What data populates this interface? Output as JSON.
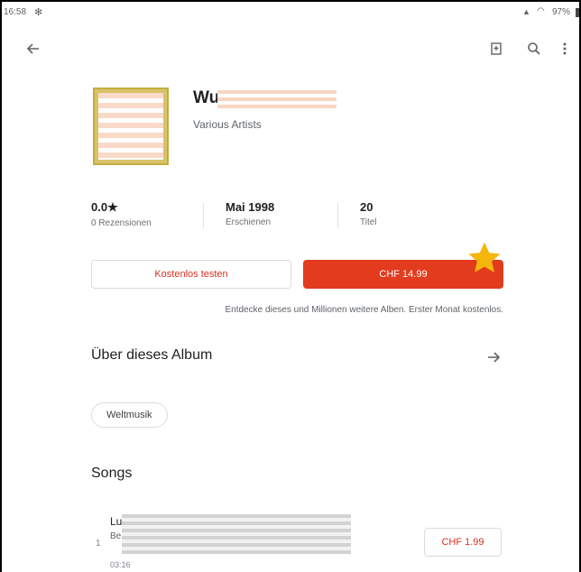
{
  "status_bar": {
    "time": "16:58",
    "battery": "97%",
    "notification_icon": "snowflake-icon"
  },
  "toolbar": {
    "icons": [
      "back-arrow-icon",
      "bookmark-add-icon",
      "search-icon",
      "more-vert-icon"
    ]
  },
  "album": {
    "title_visible": "Wu",
    "artist": "Various Artists"
  },
  "stats": [
    {
      "value": "0.0★",
      "label": "0 Rezensionen"
    },
    {
      "value": "Mai 1998",
      "label": "Erschienen"
    },
    {
      "value": "20",
      "label": "Titel"
    }
  ],
  "buttons": {
    "trial": "Kostenlos testen",
    "buy": "CHF 14.99"
  },
  "promo_text": "Entdecke dieses und Millionen weitere Alben. Erster Monat kostenlos.",
  "about": {
    "heading": "Über dieses Album"
  },
  "genre_chip": "Weltmusik",
  "songs": {
    "heading": "Songs",
    "items": [
      {
        "number": "1",
        "title_visible": "Lu",
        "artist_visible": "Be",
        "duration": "03:16",
        "price": "CHF 1.99"
      }
    ]
  },
  "colors": {
    "accent": "#e23b1d",
    "price_text": "#d93025",
    "star": "#f5b50a"
  }
}
